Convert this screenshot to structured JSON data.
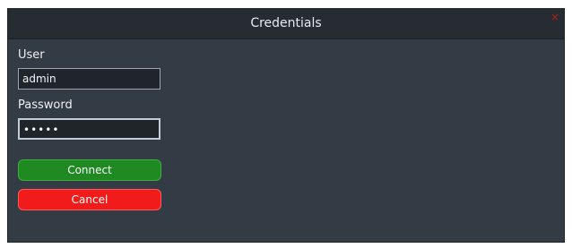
{
  "dialog": {
    "title": "Credentials",
    "close_label": "×"
  },
  "form": {
    "user_label": "User",
    "user_value": "admin",
    "password_label": "Password",
    "password_value": "•••••"
  },
  "buttons": {
    "connect_label": "Connect",
    "cancel_label": "Cancel"
  },
  "colors": {
    "window_bg": "#333c44",
    "titlebar_bg": "#262c31",
    "connect_bg": "#1f8a22",
    "cancel_bg": "#f21b1b",
    "close_color": "#b51f1f"
  }
}
